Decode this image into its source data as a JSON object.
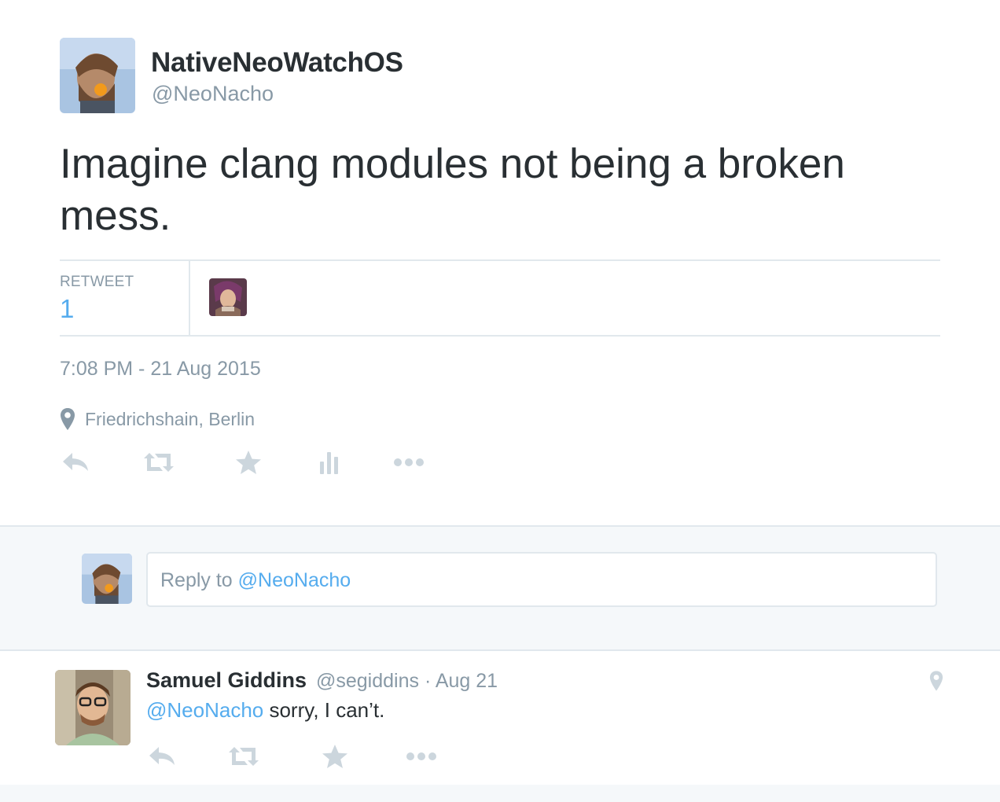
{
  "tweet": {
    "author_name": "NativeNeoWatchOS",
    "author_handle": "@NeoNacho",
    "text": "Imagine clang modules not being a broken mess.",
    "stats": {
      "retweet_label": "RETWEET",
      "retweet_count": "1"
    },
    "timestamp": "7:08 PM - 21 Aug 2015",
    "location": "Friedrichshain, Berlin",
    "actions": [
      "reply-icon",
      "retweet-icon",
      "favorite-icon",
      "analytics-icon",
      "more-icon"
    ]
  },
  "reply_box": {
    "prefix": "Reply to ",
    "mention": "@NeoNacho"
  },
  "reply_tweet": {
    "author_name": "Samuel Giddins",
    "meta": "@segiddins · Aug 21",
    "mention": "@NeoNacho",
    "text": " sorry, I can’t.",
    "actions": [
      "reply-icon",
      "retweet-icon",
      "favorite-icon",
      "more-icon"
    ]
  },
  "colors": {
    "accent": "#55acee",
    "muted": "#8899a6",
    "icon": "#ccd6dd",
    "text": "#292f33",
    "border": "#e1e8ed",
    "band": "#f5f8fa"
  }
}
